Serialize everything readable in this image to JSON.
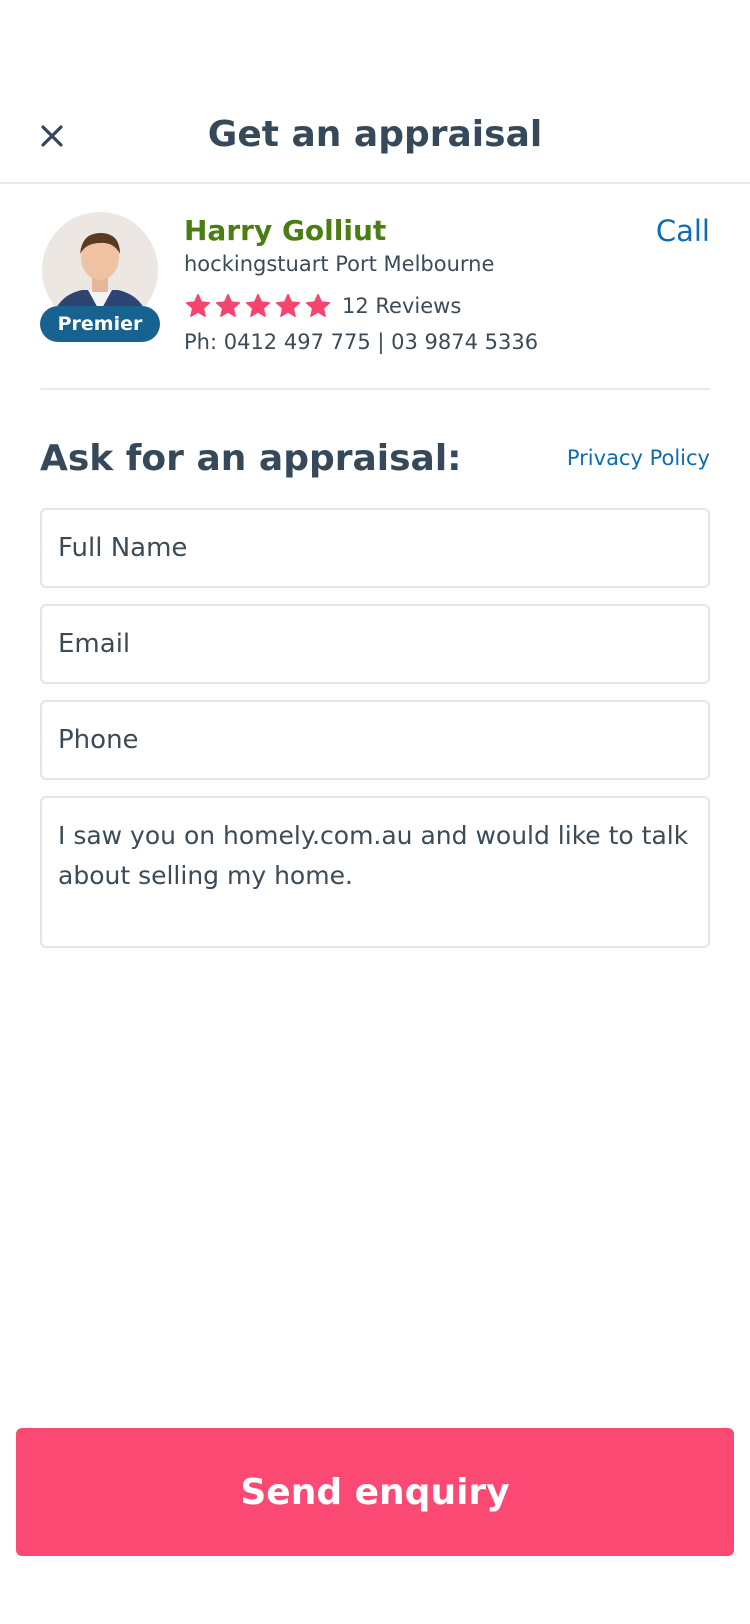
{
  "header": {
    "title": "Get an appraisal"
  },
  "agent": {
    "name": "Harry Golliut",
    "agency": "hockingstuart Port Melbourne",
    "badge": "Premier",
    "rating": 5,
    "reviews": "12 Reviews",
    "phone": "Ph: 0412 497 775 | 03 9874 5336",
    "call_label": "Call"
  },
  "form": {
    "heading": "Ask for an appraisal:",
    "privacy_label": "Privacy Policy",
    "full_name_placeholder": "Full Name",
    "email_placeholder": "Email",
    "phone_placeholder": "Phone",
    "message_value": "I saw you on homely.com.au and would like to talk about selling my home.",
    "submit_label": "Send enquiry"
  },
  "colors": {
    "brand_pink": "#fa4a74",
    "agent_green": "#4b7d12",
    "link_blue": "#0e6cb3",
    "badge_blue": "#17628f",
    "star_pink": "#f5456f",
    "heading_dark": "#35495a"
  },
  "icons": {
    "close": "close-icon",
    "star": "star-icon"
  }
}
